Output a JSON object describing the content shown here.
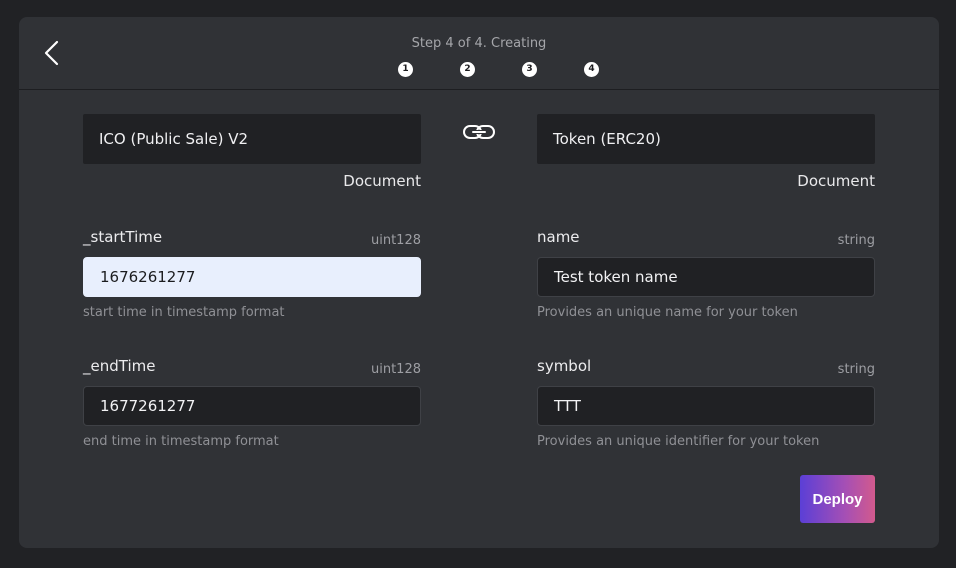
{
  "header": {
    "step_text": "Step 4 of 4. Creating",
    "steps": [
      "1",
      "2",
      "3",
      "4"
    ]
  },
  "left_document": {
    "title": "ICO (Public Sale) V2",
    "label": "Document"
  },
  "right_document": {
    "title": "Token (ERC20)",
    "label": "Document"
  },
  "left_fields": [
    {
      "label": "_startTime",
      "type": "uint128",
      "value": "1676261277",
      "help": "start time in timestamp format"
    },
    {
      "label": "_endTime",
      "type": "uint128",
      "value": "1677261277",
      "help": "end time in timestamp format"
    }
  ],
  "right_fields": [
    {
      "label": "name",
      "type": "string",
      "value": "Test token name",
      "help": "Provides an unique name for your token"
    },
    {
      "label": "symbol",
      "type": "string",
      "value": "TTT",
      "help": "Provides an unique identifier for your token"
    }
  ],
  "actions": {
    "deploy_label": "Deploy"
  },
  "icons": {
    "back": "chevron-left-icon",
    "link": "link-icon"
  },
  "colors": {
    "panel": "#303236",
    "input": "#202124",
    "active_input": "#e8effd",
    "deploy_gradient_start": "#5b3fd6",
    "deploy_gradient_end": "#d25a8d"
  }
}
